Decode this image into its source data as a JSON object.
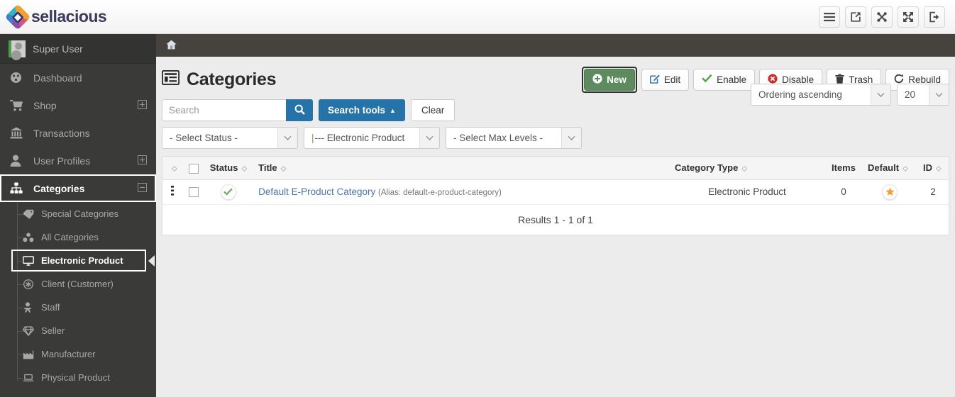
{
  "brand": {
    "name": "sellacious",
    "logo_icon": "diamond-logo-icon"
  },
  "topbar": {
    "icons": [
      {
        "name": "menu-icon",
        "label": "Menu"
      },
      {
        "name": "external-link-icon",
        "label": "Preview site"
      },
      {
        "name": "joomla-icon",
        "label": "Joomla"
      },
      {
        "name": "fullscreen-icon",
        "label": "Fullscreen"
      },
      {
        "name": "logout-icon",
        "label": "Logout"
      }
    ]
  },
  "sidebar": {
    "user": "Super User",
    "items": [
      {
        "label": "Dashboard",
        "icon": "dashboard-icon",
        "expand": "",
        "active": false
      },
      {
        "label": "Shop",
        "icon": "cart-icon",
        "expand": "+",
        "active": false
      },
      {
        "label": "Transactions",
        "icon": "bank-icon",
        "expand": "",
        "active": false
      },
      {
        "label": "User Profiles",
        "icon": "user-icon",
        "expand": "+",
        "active": false
      },
      {
        "label": "Categories",
        "icon": "sitemap-icon",
        "expand": "–",
        "active": true
      }
    ],
    "subitems": [
      {
        "label": "Special Categories",
        "icon": "tag-icon",
        "selected": false
      },
      {
        "label": "All Categories",
        "icon": "cubes-icon",
        "selected": false
      },
      {
        "label": "Electronic Product",
        "icon": "monitor-icon",
        "selected": true
      },
      {
        "label": "Client (Customer)",
        "icon": "asterisk-circle-icon",
        "selected": false
      },
      {
        "label": "Staff",
        "icon": "person-icon",
        "selected": false
      },
      {
        "label": "Seller",
        "icon": "diamond-icon",
        "selected": false
      },
      {
        "label": "Manufacturer",
        "icon": "factory-icon",
        "selected": false
      },
      {
        "label": "Physical Product",
        "icon": "box-icon",
        "selected": false
      }
    ]
  },
  "breadcrumb": {
    "home_icon": "home-icon"
  },
  "page": {
    "title": "Categories",
    "title_icon": "list-icon"
  },
  "toolbar": {
    "new": "New",
    "edit": "Edit",
    "enable": "Enable",
    "disable": "Disable",
    "trash": "Trash",
    "rebuild": "Rebuild"
  },
  "search": {
    "value": "",
    "placeholder": "Search",
    "search_button_icon": "search-icon",
    "tools_label": "Search tools",
    "tools_caret": "▲",
    "clear_label": "Clear"
  },
  "filters": [
    {
      "name": "status-filter",
      "value": "- Select Status -",
      "pipe": false
    },
    {
      "name": "category-filter",
      "value": "--- Electronic Product",
      "pipe": true
    },
    {
      "name": "max-levels-filter",
      "value": "- Select Max Levels -",
      "pipe": false
    }
  ],
  "right_filters": [
    {
      "name": "ordering-select",
      "value": "Ordering ascending"
    },
    {
      "name": "limit-select",
      "value": "20"
    }
  ],
  "table": {
    "columns": [
      {
        "key": "handle",
        "label": "",
        "sortable": true
      },
      {
        "key": "check",
        "label": "",
        "sortable": false
      },
      {
        "key": "status",
        "label": "Status",
        "sortable": true
      },
      {
        "key": "title",
        "label": "Title",
        "sortable": true
      },
      {
        "key": "type",
        "label": "Category Type",
        "sortable": true
      },
      {
        "key": "items",
        "label": "Items",
        "sortable": false
      },
      {
        "key": "default",
        "label": "Default",
        "sortable": true
      },
      {
        "key": "id",
        "label": "ID",
        "sortable": true
      }
    ],
    "rows": [
      {
        "status_icon": "check-circle-icon",
        "title": "Default E-Product Category",
        "alias": "(Alias: default-e-product-category)",
        "type": "Electronic Product",
        "items": "0",
        "default_icon": "star-icon",
        "id": "2"
      }
    ],
    "results_text": "Results 1 - 1 of 1"
  },
  "colors": {
    "accent_blue": "#2573a7",
    "primary_green": "#5d8a5e",
    "sidebar_bg": "#3a3a38",
    "breadcrumb_bg": "#46433f",
    "link_blue": "#4a77a8",
    "star_orange": "#f0a33a",
    "status_green": "#6aaa64",
    "disable_red": "#c9302c"
  }
}
